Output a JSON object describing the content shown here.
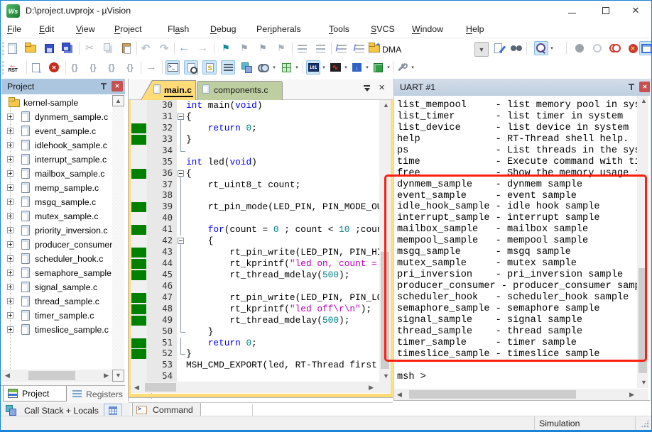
{
  "window": {
    "title": "D:\\project.uvprojx - µVision"
  },
  "menu": {
    "items": [
      {
        "label": "File",
        "u": 0
      },
      {
        "label": "Edit",
        "u": 0
      },
      {
        "label": "View",
        "u": 0
      },
      {
        "label": "Project",
        "u": 0
      },
      {
        "label": "Flash",
        "u": 2
      },
      {
        "label": "Debug",
        "u": 0
      },
      {
        "label": "Peripherals",
        "u": 3
      },
      {
        "label": "Tools",
        "u": 0
      },
      {
        "label": "SVCS",
        "u": 0
      },
      {
        "label": "Window",
        "u": 0
      },
      {
        "label": "Help",
        "u": 0
      }
    ]
  },
  "toolbar": {
    "search_value": "DMA"
  },
  "project": {
    "title": "Project",
    "root": "kernel-sample",
    "files": [
      "dynmem_sample.c",
      "event_sample.c",
      "idlehook_sample.c",
      "interrupt_sample.c",
      "mailbox_sample.c",
      "memp_sample.c",
      "msgq_sample.c",
      "mutex_sample.c",
      "priority_inversion.c",
      "producer_consumer.c",
      "scheduler_hook.c",
      "semaphore_sample.c",
      "signal_sample.c",
      "thread_sample.c",
      "timer_sample.c",
      "timeslice_sample.c"
    ],
    "tab_project": "Project",
    "tab_registers": "Registers",
    "callstack_label": "Call Stack + Locals"
  },
  "editor": {
    "tabs": [
      "main.c",
      "components.c"
    ],
    "command_tab": "Command",
    "lines": [
      {
        "n": 30,
        "f": "",
        "g": 0,
        "s": [
          [
            "k",
            "int"
          ],
          [
            "p",
            " main("
          ],
          [
            "k",
            "void"
          ],
          [
            "p",
            ")"
          ]
        ]
      },
      {
        "n": 31,
        "f": "b",
        "g": 0,
        "s": [
          [
            "p",
            "{"
          ]
        ]
      },
      {
        "n": 32,
        "f": "v",
        "g": 1,
        "s": [
          [
            "p",
            "    "
          ],
          [
            "k",
            "return"
          ],
          [
            "p",
            " "
          ],
          [
            "n",
            "0"
          ],
          [
            "p",
            ";"
          ]
        ]
      },
      {
        "n": 33,
        "f": "v",
        "g": 1,
        "s": [
          [
            "p",
            "}"
          ]
        ]
      },
      {
        "n": 34,
        "f": "e",
        "g": 0,
        "s": []
      },
      {
        "n": 35,
        "f": "",
        "g": 0,
        "s": [
          [
            "k",
            "int"
          ],
          [
            "p",
            " led("
          ],
          [
            "k",
            "void"
          ],
          [
            "p",
            ")"
          ]
        ]
      },
      {
        "n": 36,
        "f": "b",
        "g": 1,
        "s": [
          [
            "p",
            "{"
          ]
        ]
      },
      {
        "n": 37,
        "f": "v",
        "g": 0,
        "s": [
          [
            "p",
            "    rt_uint8_t count;"
          ]
        ]
      },
      {
        "n": 38,
        "f": "v",
        "g": 0,
        "s": []
      },
      {
        "n": 39,
        "f": "v",
        "g": 1,
        "s": [
          [
            "p",
            "    rt_pin_mode(LED_PIN, PIN_MODE_OUTPUT);"
          ]
        ]
      },
      {
        "n": 40,
        "f": "v",
        "g": 0,
        "s": []
      },
      {
        "n": 41,
        "f": "v",
        "g": 1,
        "s": [
          [
            "p",
            "    "
          ],
          [
            "k",
            "for"
          ],
          [
            "p",
            "(count = "
          ],
          [
            "n",
            "0"
          ],
          [
            "p",
            " ; count < "
          ],
          [
            "n",
            "10"
          ],
          [
            "p",
            " ;count++)"
          ]
        ]
      },
      {
        "n": 42,
        "f": "b",
        "g": 0,
        "s": [
          [
            "p",
            "    {"
          ]
        ]
      },
      {
        "n": 43,
        "f": "v",
        "g": 1,
        "s": [
          [
            "p",
            "        rt_pin_write(LED_PIN, PIN_HIGH);"
          ]
        ]
      },
      {
        "n": 44,
        "f": "v",
        "g": 1,
        "s": [
          [
            "p",
            "        rt_kprintf("
          ],
          [
            "s",
            "\"led on, count = %d\\r\\n\""
          ],
          [
            "p",
            ", count);"
          ]
        ]
      },
      {
        "n": 45,
        "f": "v",
        "g": 1,
        "s": [
          [
            "p",
            "        rt_thread_mdelay("
          ],
          [
            "n",
            "500"
          ],
          [
            "p",
            ");"
          ]
        ]
      },
      {
        "n": 46,
        "f": "v",
        "g": 0,
        "s": []
      },
      {
        "n": 47,
        "f": "v",
        "g": 1,
        "s": [
          [
            "p",
            "        rt_pin_write(LED_PIN, PIN_LOW);"
          ]
        ]
      },
      {
        "n": 48,
        "f": "v",
        "g": 1,
        "s": [
          [
            "p",
            "        rt_kprintf("
          ],
          [
            "s",
            "\"led off\\r\\n\""
          ],
          [
            "p",
            ");"
          ]
        ]
      },
      {
        "n": 49,
        "f": "v",
        "g": 1,
        "s": [
          [
            "p",
            "        rt_thread_mdelay("
          ],
          [
            "n",
            "500"
          ],
          [
            "p",
            ");"
          ]
        ]
      },
      {
        "n": 50,
        "f": "e",
        "g": 0,
        "s": [
          [
            "p",
            "    }"
          ]
        ]
      },
      {
        "n": 51,
        "f": "v",
        "g": 1,
        "s": [
          [
            "p",
            "    "
          ],
          [
            "k",
            "return"
          ],
          [
            "p",
            " "
          ],
          [
            "n",
            "0"
          ],
          [
            "p",
            ";"
          ]
        ]
      },
      {
        "n": 52,
        "f": "e",
        "g": 1,
        "s": [
          [
            "p",
            "}"
          ]
        ]
      },
      {
        "n": 53,
        "f": "",
        "g": 0,
        "s": [
          [
            "p",
            "MSH_CMD_EXPORT(led, RT-Thread first led sample);"
          ]
        ]
      },
      {
        "n": 54,
        "f": "",
        "g": 0,
        "s": []
      }
    ]
  },
  "uart": {
    "title": "UART #1",
    "entries": [
      [
        "list_mempool",
        "list memory pool in system"
      ],
      [
        "list_timer",
        "list timer in system"
      ],
      [
        "list_device",
        "list device in system"
      ],
      [
        "help",
        "RT-Thread shell help."
      ],
      [
        "ps",
        "List threads in the system."
      ],
      [
        "time",
        "Execute command with time."
      ],
      [
        "free",
        "Show the memory usage in the system."
      ],
      [
        "dynmem_sample",
        "dynmem sample"
      ],
      [
        "event_sample",
        "event sample"
      ],
      [
        "idle_hook_sample",
        "idle hook sample"
      ],
      [
        "interrupt_sample",
        "interrupt sample"
      ],
      [
        "mailbox_sample",
        "mailbox sample"
      ],
      [
        "mempool_sample",
        "mempool sample"
      ],
      [
        "msgq_sample",
        "msgq sample"
      ],
      [
        "mutex_sample",
        "mutex sample"
      ],
      [
        "pri_inversion",
        "pri_inversion sample"
      ],
      [
        "producer_consumer",
        "producer_consumer sample"
      ],
      [
        "scheduler_hook",
        "scheduler_hook sample"
      ],
      [
        "semaphore_sample",
        "semaphore sample"
      ],
      [
        "signal_sample",
        "signal sample"
      ],
      [
        "thread_sample",
        "thread sample"
      ],
      [
        "timer_sample",
        "timer sample"
      ],
      [
        "timeslice_sample",
        "timeslice sample"
      ]
    ],
    "prompt": "msh >"
  },
  "status": {
    "mode": "Simulation"
  },
  "colors": {
    "accent_red": "#ff1e10",
    "active_tab": "#ffdc78",
    "inactive_tab": "#becea1",
    "header_project": "#adc6e0",
    "header_uart": "#c5d3e1",
    "green_bar": "#008000"
  }
}
